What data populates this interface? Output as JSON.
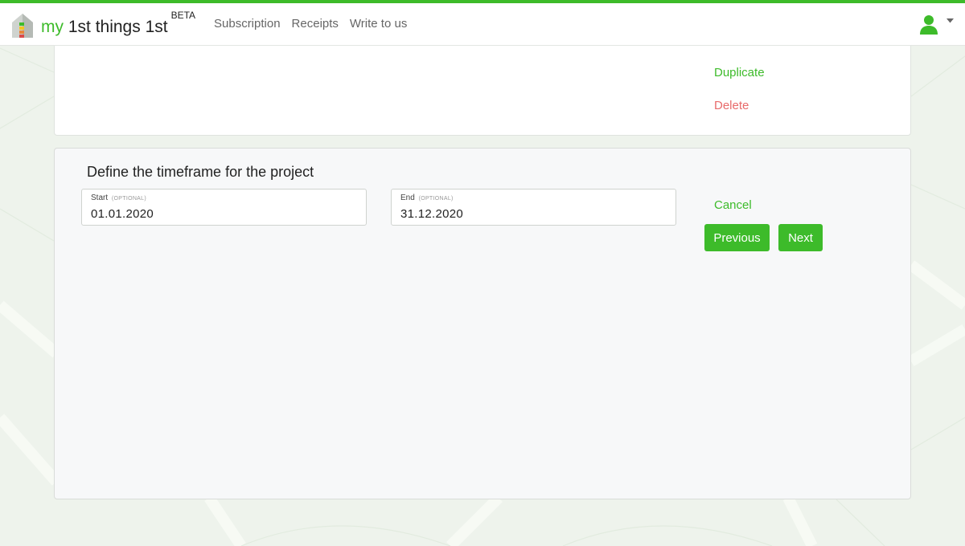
{
  "colors": {
    "brand_green": "#3dbb2a",
    "delete_red": "#e86a6a",
    "background": "#eef3ec"
  },
  "brand": {
    "logo_icon": "house-logo-icon",
    "prefix": "my",
    "name": "1st things 1st",
    "badge": "BETA"
  },
  "nav": {
    "items": [
      {
        "label": "Subscription"
      },
      {
        "label": "Receipts"
      },
      {
        "label": "Write to us"
      }
    ]
  },
  "user_menu": {
    "icon": "user-icon",
    "caret": "caret-down-icon"
  },
  "project_card": {
    "duplicate_label": "Duplicate",
    "delete_label": "Delete"
  },
  "timeframe": {
    "title": "Define the timeframe for the project",
    "start": {
      "label": "Start",
      "optional_tag": "(OPTIONAL)",
      "value": "01.01.2020"
    },
    "end": {
      "label": "End",
      "optional_tag": "(OPTIONAL)",
      "value": "31.12.2020"
    },
    "cancel_label": "Cancel",
    "previous_label": "Previous",
    "next_label": "Next"
  }
}
